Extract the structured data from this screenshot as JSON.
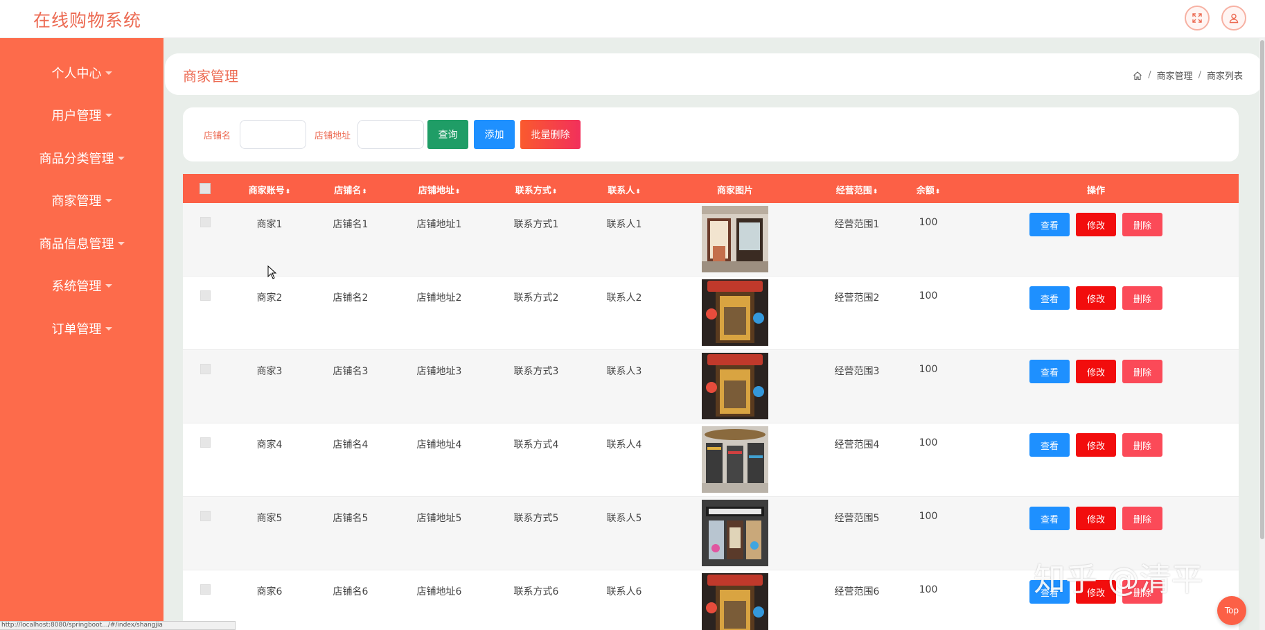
{
  "app": {
    "title": "在线购物系统"
  },
  "topbar": {
    "fullscreen_icon": "fullscreen-icon",
    "user_icon": "user-icon"
  },
  "sidebar": {
    "items": [
      {
        "label": "个人中心"
      },
      {
        "label": "用户管理"
      },
      {
        "label": "商品分类管理"
      },
      {
        "label": "商家管理"
      },
      {
        "label": "商品信息管理"
      },
      {
        "label": "系统管理"
      },
      {
        "label": "订单管理"
      }
    ]
  },
  "page": {
    "title": "商家管理",
    "breadcrumb": [
      "商家管理",
      "商家列表"
    ]
  },
  "search": {
    "shop_name_label": "店铺名",
    "shop_name_value": "",
    "shop_address_label": "店铺地址",
    "shop_address_value": "",
    "query_label": "查询",
    "add_label": "添加",
    "batch_delete_label": "批量删除"
  },
  "table": {
    "columns": [
      "商家账号",
      "店铺名",
      "店铺地址",
      "联系方式",
      "联系人",
      "商家图片",
      "经营范围",
      "余额",
      "操作"
    ],
    "sort_glyph": "⬍",
    "rows": [
      {
        "account": "商家1",
        "shop": "店铺名1",
        "address": "店铺地址1",
        "contact": "联系方式1",
        "person": "联系人1",
        "scope": "经营范围1",
        "balance": "100",
        "image": "storefront-1"
      },
      {
        "account": "商家2",
        "shop": "店铺名2",
        "address": "店铺地址2",
        "contact": "联系方式2",
        "person": "联系人2",
        "scope": "经营范围2",
        "balance": "100",
        "image": "storefront-2"
      },
      {
        "account": "商家3",
        "shop": "店铺名3",
        "address": "店铺地址3",
        "contact": "联系方式3",
        "person": "联系人3",
        "scope": "经营范围3",
        "balance": "100",
        "image": "storefront-2"
      },
      {
        "account": "商家4",
        "shop": "店铺名4",
        "address": "店铺地址4",
        "contact": "联系方式4",
        "person": "联系人4",
        "scope": "经营范围4",
        "balance": "100",
        "image": "storefront-3"
      },
      {
        "account": "商家5",
        "shop": "店铺名5",
        "address": "店铺地址5",
        "contact": "联系方式5",
        "person": "联系人5",
        "scope": "经营范围5",
        "balance": "100",
        "image": "storefront-4"
      },
      {
        "account": "商家6",
        "shop": "店铺名6",
        "address": "店铺地址6",
        "contact": "联系方式6",
        "person": "联系人6",
        "scope": "经营范围6",
        "balance": "100",
        "image": "storefront-2"
      }
    ],
    "actions": {
      "view": "查看",
      "edit": "修改",
      "delete": "删除"
    }
  },
  "watermark": "知乎 @清平",
  "top_button": "Top",
  "statusbar": "http://localhost:8080/springboot.../#/index/shangjia",
  "colors": {
    "brand": "#fd6b4b",
    "header": "#fc6046",
    "query": "#1f9d66",
    "add": "#1e90ff",
    "batch_delete": "#f1474f",
    "edit": "#f20d0d",
    "delete": "#fb4a58"
  }
}
